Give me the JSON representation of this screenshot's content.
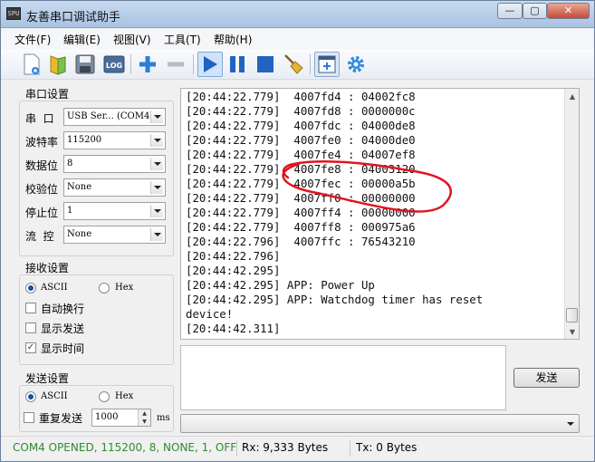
{
  "window": {
    "title": "友善串口调试助手",
    "icon_text": "SPU"
  },
  "menu": [
    "文件(F)",
    "编辑(E)",
    "视图(V)",
    "工具(T)",
    "帮助(H)"
  ],
  "toolbar": {
    "log_label": "LOG"
  },
  "serial": {
    "group_title": "串口设置",
    "port_label": "串  口",
    "port_value": "USB Ser... (COM4",
    "baud_label": "波特率",
    "baud_value": "115200",
    "databits_label": "数据位",
    "databits_value": "8",
    "parity_label": "校验位",
    "parity_value": "None",
    "stopbits_label": "停止位",
    "stopbits_value": "1",
    "flow_label": "流  控",
    "flow_value": "None"
  },
  "receive": {
    "group_title": "接收设置",
    "ascii_label": "ASCII",
    "hex_label": "Hex",
    "mode": "ASCII",
    "auto_wrap_label": "自动换行",
    "auto_wrap": false,
    "show_send_label": "显示发送",
    "show_send": false,
    "show_time_label": "显示时间",
    "show_time": true
  },
  "send": {
    "group_title": "发送设置",
    "ascii_label": "ASCII",
    "hex_label": "Hex",
    "mode": "ASCII",
    "repeat_label": "重复发送",
    "repeat": false,
    "interval_value": "1000",
    "interval_unit": "ms",
    "send_button": "发送"
  },
  "console": {
    "text": "[20:44:22.779]  4007fd4 : 04002fc8\n[20:44:22.779]  4007fd8 : 0000000c\n[20:44:22.779]  4007fdc : 04000de8\n[20:44:22.779]  4007fe0 : 04000de0\n[20:44:22.779]  4007fe4 : 04007ef8\n[20:44:22.779]  4007fe8 : 04003120\n[20:44:22.779]  4007fec : 00000a5b\n[20:44:22.779]  4007ff0 : 00000000\n[20:44:22.779]  4007ff4 : 00000000\n[20:44:22.779]  4007ff8 : 000975a6\n[20:44:22.796]  4007ffc : 76543210\n[20:44:22.796]\n[20:44:42.295]\n[20:44:42.295] APP: Power Up\n[20:44:42.295] APP: Watchdog timer has reset\ndevice!\n[20:44:42.311]"
  },
  "status": {
    "connection": "COM4 OPENED, 115200, 8, NONE, 1, OFF",
    "rx": "Rx: 9,333 Bytes",
    "tx": "Tx: 0 Bytes"
  },
  "colors": {
    "status_ok": "#2e8b2e",
    "annotation": "#e0141e",
    "accent": "#1e6fc8"
  }
}
